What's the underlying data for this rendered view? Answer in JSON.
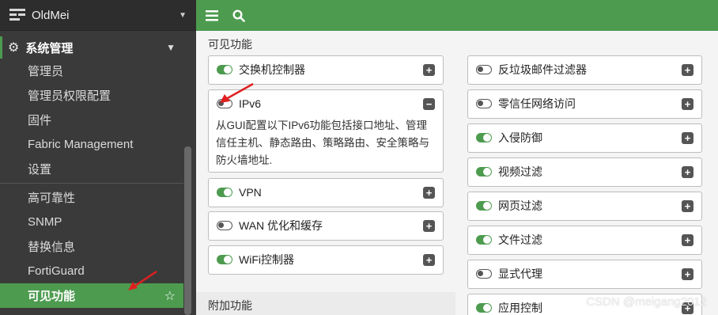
{
  "brand": {
    "name": "OldMei"
  },
  "nav": {
    "section_label": "系统管理",
    "items": [
      {
        "label": "管理员"
      },
      {
        "label": "管理员权限配置"
      },
      {
        "label": "固件"
      },
      {
        "label": "Fabric Management"
      },
      {
        "label": "设置"
      },
      {
        "label": "高可靠性"
      },
      {
        "label": "SNMP"
      },
      {
        "label": "替换信息"
      },
      {
        "label": "FortiGuard"
      },
      {
        "label": "可见功能",
        "active": true
      }
    ]
  },
  "main": {
    "visible_features_title": "可见功能",
    "additional_features_title": "附加功能",
    "left_features": [
      {
        "label": "交换机控制器",
        "enabled": true
      },
      {
        "label": "IPv6",
        "enabled": false,
        "expanded": true,
        "description": "从GUI配置以下IPv6功能包括接口地址、管理信任主机、静态路由、策略路由、安全策略与防火墙地址."
      },
      {
        "label": "VPN",
        "enabled": true
      },
      {
        "label": "WAN 优化和缓存",
        "enabled": false
      },
      {
        "label": "WiFi控制器",
        "enabled": true
      }
    ],
    "right_features": [
      {
        "label": "反垃圾邮件过滤器",
        "enabled": false
      },
      {
        "label": "零信任网络访问",
        "enabled": false
      },
      {
        "label": "入侵防御",
        "enabled": true
      },
      {
        "label": "视频过滤",
        "enabled": true
      },
      {
        "label": "网页过滤",
        "enabled": true
      },
      {
        "label": "文件过滤",
        "enabled": true
      },
      {
        "label": "显式代理",
        "enabled": false
      },
      {
        "label": "应用控制",
        "enabled": true
      }
    ]
  },
  "icons": {
    "menu": "hamburger-icon",
    "search": "search-icon",
    "expand": "plus-icon",
    "collapse": "minus-icon",
    "favorite": "star-icon",
    "settings": "gear-icon"
  },
  "watermark": "CSDN @meigang2012",
  "colors": {
    "accent": "#4d9b4f",
    "sidebar": "#3a3a3a",
    "annotation_arrow": "#e02020"
  }
}
